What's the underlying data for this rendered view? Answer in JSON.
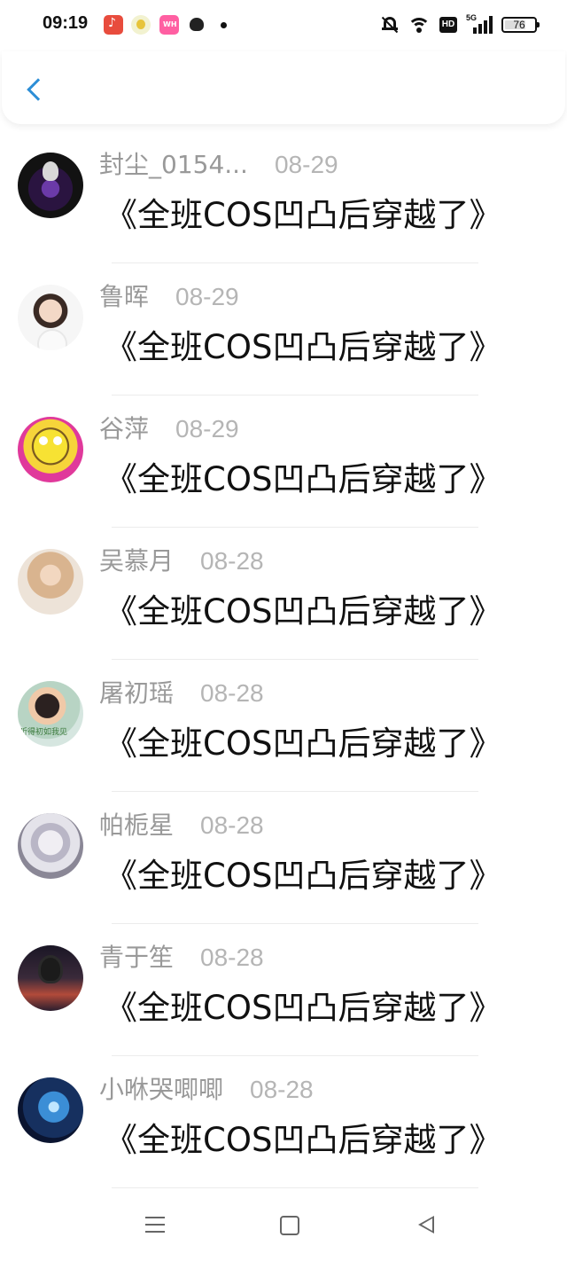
{
  "status_bar": {
    "time": "09:19",
    "network": "5G",
    "hd_label": "HD",
    "battery_percent": "76",
    "battery_level": 0.76
  },
  "header": {
    "back_icon": "chevron-left-icon",
    "accent_color": "#2d8ed6"
  },
  "list": {
    "items": [
      {
        "name": "封尘_0154...",
        "date": "08-29",
        "message": "《全班COS凹凸后穿越了》"
      },
      {
        "name": "鲁晖",
        "date": "08-29",
        "message": "《全班COS凹凸后穿越了》"
      },
      {
        "name": "谷萍",
        "date": "08-29",
        "message": "《全班COS凹凸后穿越了》"
      },
      {
        "name": "吴慕月",
        "date": "08-28",
        "message": "《全班COS凹凸后穿越了》"
      },
      {
        "name": "屠初瑶",
        "date": "08-28",
        "message": "《全班COS凹凸后穿越了》"
      },
      {
        "name": "帕栀星",
        "date": "08-28",
        "message": "《全班COS凹凸后穿越了》"
      },
      {
        "name": "青于笙",
        "date": "08-28",
        "message": "《全班COS凹凸后穿越了》"
      },
      {
        "name": "小咻哭唧唧",
        "date": "08-28",
        "message": "《全班COS凹凸后穿越了》"
      }
    ]
  },
  "nav_bar": {
    "icons": [
      "menu-icon",
      "home-icon",
      "back-triangle-icon"
    ]
  }
}
